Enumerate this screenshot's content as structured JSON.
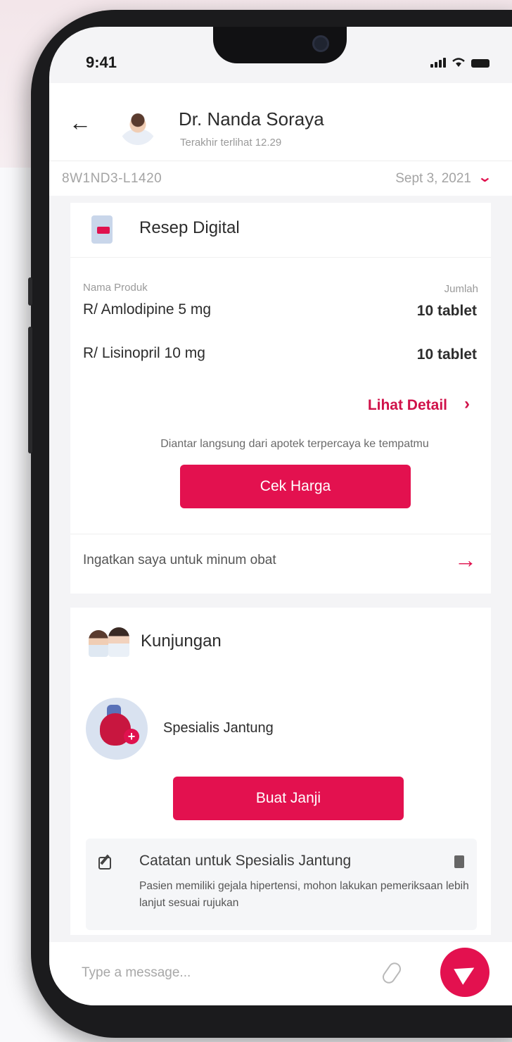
{
  "status_bar": {
    "time": "9:41"
  },
  "header": {
    "doctor_name": "Dr. Nanda Soraya",
    "last_seen": "Terakhir terlihat 12.29"
  },
  "order": {
    "id": "8W1ND3-L1420",
    "date": "Sept 3, 2021"
  },
  "prescription": {
    "title": "Resep Digital",
    "col_product": "Nama Produk",
    "col_qty": "Jumlah",
    "items": [
      {
        "name": "R/ Amlodipine 5 mg",
        "qty": "10 tablet"
      },
      {
        "name": "R/ Lisinopril 10 mg",
        "qty": "10 tablet"
      }
    ],
    "detail_link": "Lihat Detail",
    "delivery_note": "Diantar langsung dari apotek terpercaya ke tempatmu",
    "check_price_button": "Cek Harga",
    "reminder": "Ingatkan saya untuk minum obat"
  },
  "visit": {
    "title": "Kunjungan",
    "specialist": "Spesialis Jantung",
    "appointment_button": "Buat Janji",
    "note_title": "Catatan untuk Spesialis Jantung",
    "note_body": "Pasien memiliki gejala hipertensi, mohon lakukan pemeriksaan lebih lanjut sesuai rujukan"
  },
  "composer": {
    "placeholder": "Type a message..."
  },
  "colors": {
    "accent": "#e3114f",
    "text": "#2c2c2c",
    "muted": "#9a9a9a"
  },
  "icons": [
    "back-arrow-icon",
    "chevron-down-icon",
    "prescription-icon",
    "chevron-right-icon",
    "arrow-right-icon",
    "doctors-icon",
    "heart-icon",
    "edit-icon",
    "copy-icon",
    "paperclip-icon",
    "send-icon"
  ]
}
